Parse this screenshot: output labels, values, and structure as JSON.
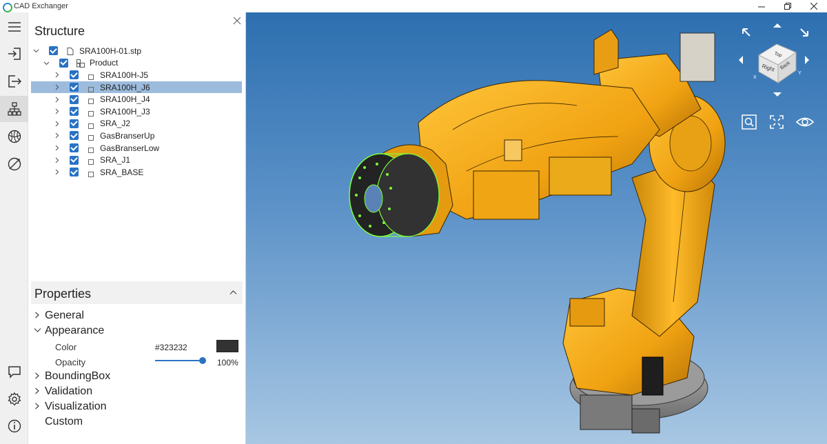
{
  "app": {
    "title": "CAD Exchanger",
    "window_controls": [
      "minimize",
      "restore",
      "close"
    ]
  },
  "rail": {
    "items": [
      {
        "name": "menu-icon",
        "active": false
      },
      {
        "name": "import-icon",
        "active": false
      },
      {
        "name": "export-icon",
        "active": false
      },
      {
        "name": "structure-icon",
        "active": true
      },
      {
        "name": "globe-icon",
        "active": false
      },
      {
        "name": "measure-icon",
        "active": false
      }
    ],
    "bottom_items": [
      "feedback-icon",
      "settings-icon",
      "info-icon"
    ]
  },
  "structure": {
    "title": "Structure",
    "root": {
      "label": "SRA100H-01.stp",
      "checked": true,
      "expanded": true
    },
    "product": {
      "label": "Product",
      "checked": true,
      "expanded": true
    },
    "children": [
      {
        "label": "SRA100H-J5",
        "checked": true,
        "selected": false
      },
      {
        "label": "SRA100H_J6",
        "checked": true,
        "selected": true
      },
      {
        "label": "SRA100H_J4",
        "checked": true,
        "selected": false
      },
      {
        "label": "SRA100H_J3",
        "checked": true,
        "selected": false
      },
      {
        "label": "SRA_J2",
        "checked": true,
        "selected": false
      },
      {
        "label": "GasBranserUp",
        "checked": true,
        "selected": false
      },
      {
        "label": "GasBranserLow",
        "checked": true,
        "selected": false
      },
      {
        "label": "SRA_J1",
        "checked": true,
        "selected": false
      },
      {
        "label": "SRA_BASE",
        "checked": true,
        "selected": false
      }
    ]
  },
  "properties": {
    "title": "Properties",
    "sections": {
      "general": "General",
      "appearance": "Appearance",
      "boundingbox": "BoundingBox",
      "validation": "Validation",
      "visualization": "Visualization",
      "custom": "Custom"
    },
    "color_label": "Color",
    "color_value": "#323232",
    "opacity_label": "Opacity",
    "opacity_value": "100%",
    "opacity_fraction": 1.0
  },
  "viewport": {
    "viewcube": {
      "top": "Top",
      "right": "Right",
      "back": "Back",
      "x": "X",
      "y": "Y"
    },
    "background_top": "#2d6fb0",
    "background_bottom": "#a8c7e3",
    "model_color": "#f2a916",
    "highlight_color": "#7cff3a"
  }
}
